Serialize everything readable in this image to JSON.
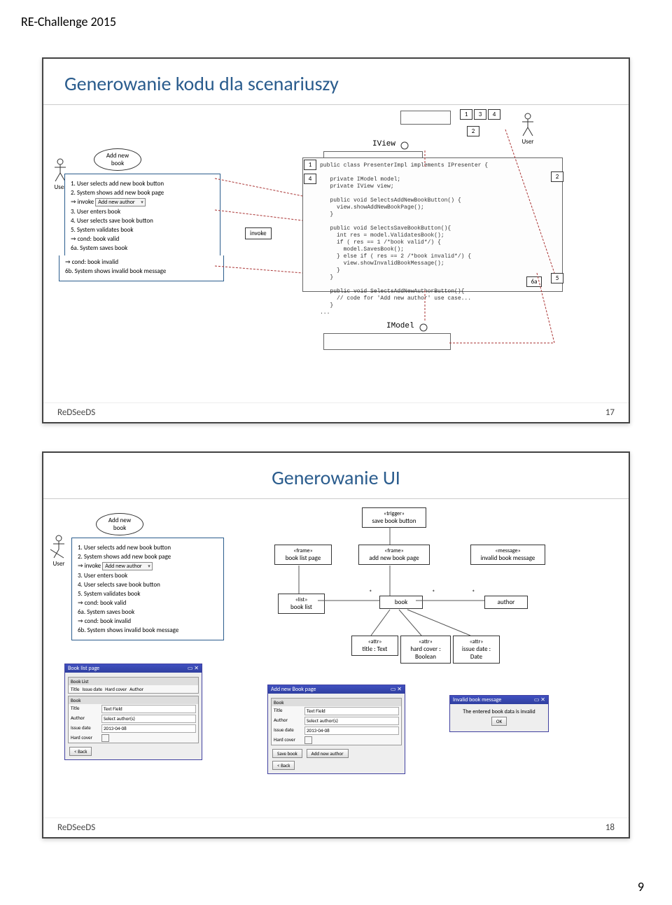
{
  "page_header": "RE-Challenge 2015",
  "page_number_bottom": "9",
  "slide17": {
    "title": "Generowanie kodu dla scenariuszy",
    "footer_left": "ReDSeeDS",
    "footer_right": "17",
    "user_label": "User",
    "user_label_right": "User",
    "usecase_label": "Add new book",
    "scenario": {
      "s1": "1. User selects add new book button",
      "s2": "2. System shows add new book page",
      "s2_invoke": "⇒ invoke",
      "s2_combo": "Add new author",
      "s3": "3. User enters book",
      "s4": "4. User selects save book button",
      "s5": "5. System validates book",
      "s5_cond": "⇒     cond: book valid",
      "s6a": "6a. System saves book",
      "s_cond2": "⇒    cond: book invalid",
      "s6b": "6b. System shows invalid book message"
    },
    "invoke_box": "invoke",
    "iview": "IView",
    "imodel": "IModel",
    "num1": "1",
    "num2": "2",
    "num3": "3",
    "num4": "4",
    "num5": "5",
    "num6a": "6a",
    "code": "public class PresenterImpl implements IPresenter {\n\n   private IModel model;\n   private IView view;\n\n   public void SelectsAddNewBookButton() {\n     view.showAddNewBookPage();\n   }\n\n   public void SelectsSaveBookButton(){\n     int res = model.ValidatesBook();\n     if ( res == 1 /*book valid*/) {\n       model.SavesBook();\n     } else if ( res == 2 /*book invalid*/) {\n       view.showInvalidBookMessage();\n     }\n   }\n\n   public void SelectsAddNewAuthorButton(){\n     // code for 'Add new author' use case...\n   }\n..."
  },
  "slide18": {
    "title": "Generowanie UI",
    "footer_left": "ReDSeeDS",
    "footer_right": "18",
    "user_label": "User",
    "usecase_label": "Add new book",
    "scenario": {
      "s1": "1. User selects add new book button",
      "s2": "2. System shows add new book page",
      "s2_invoke": "⇒ invoke",
      "s2_combo": "Add new author",
      "s3": "3. User enters book",
      "s4": "4. User selects save book button",
      "s5": "5. System validates book",
      "s5_cond": "⇒     cond: book valid",
      "s6a": "6a. System saves book",
      "s_cond2": "⇒    cond: book invalid",
      "s6b": "6b. System shows invalid book message"
    },
    "uml": {
      "trigger": {
        "stereo": "«trigger»",
        "name": "save book button"
      },
      "frame1": {
        "stereo": "«frame»",
        "name": "book list page"
      },
      "frame2": {
        "stereo": "«frame»",
        "name": "add new book page"
      },
      "msg": {
        "stereo": "«message»",
        "name": "invalid book message"
      },
      "list": {
        "stereo": "«list»",
        "name": "book list"
      },
      "book": "book",
      "author": "author",
      "attr1": {
        "stereo": "«attr»",
        "name": "title : Text"
      },
      "attr2": {
        "stereo": "«attr»",
        "name": "hard cover : Boolean"
      },
      "attr3": {
        "stereo": "«attr»",
        "name": "issue date : Date"
      }
    },
    "mock1": {
      "title": "Book list page",
      "panel1_head": "Book List",
      "cols": {
        "c1": "Title",
        "c2": "Issue date",
        "c3": "Hard cover",
        "c4": "Author"
      },
      "panel2_head": "Book",
      "row_title": "Title",
      "row_title_val": "Text Field",
      "row_author": "Author",
      "row_author_val": "Select author(s)",
      "row_issue": "Issue date",
      "row_issue_val": "2013-04-08",
      "row_hard": "Hard cover",
      "btn_back": "< Back"
    },
    "mock2": {
      "title": "Add new Book page",
      "panel_head": "Book",
      "row_title": "Title",
      "row_title_val": "Text Field",
      "row_author": "Author",
      "row_author_val": "Select author(s)",
      "row_issue": "Issue date",
      "row_issue_val": "2013-04-08",
      "row_hard": "Hard cover",
      "btn_save": "Save book",
      "btn_add": "Add new author",
      "btn_back": "< Back"
    },
    "mock3": {
      "title": "Invalid book message",
      "text": "The entered book data is invalid",
      "btn_ok": "OK"
    }
  }
}
